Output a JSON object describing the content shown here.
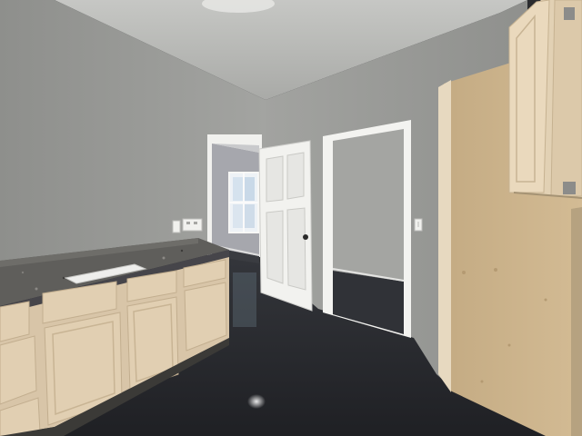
{
  "scene": {
    "kind": "interior-photo",
    "room": "kitchen-area",
    "colors": {
      "wall": "#9d9e9b",
      "ceiling": "#b5b6b3",
      "floor": "#27292d",
      "cabinet": "#dcc9ad",
      "countertop": "#5e5d5a",
      "door": "#f2f2ef",
      "plywood": "#cdb48c"
    },
    "objects": [
      "ceiling",
      "left-wall",
      "back-wall",
      "floor",
      "base-cabinets",
      "granite-countertop",
      "undermount-sink",
      "electrical-outlet",
      "open-doorway-left",
      "window",
      "interior-panel-door",
      "open-doorway-right",
      "light-switch",
      "plywood-panel",
      "upper-cabinet"
    ]
  }
}
